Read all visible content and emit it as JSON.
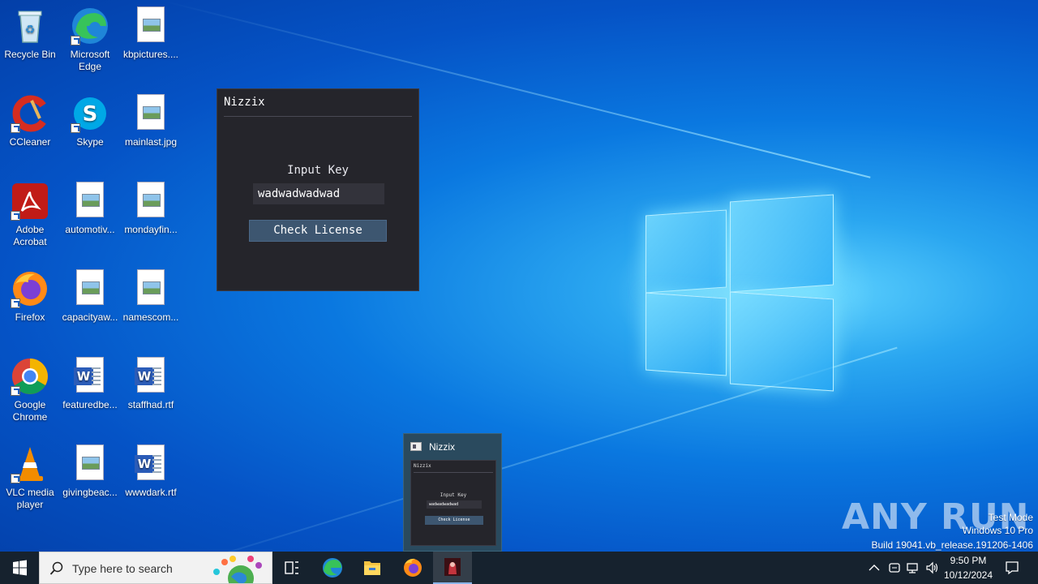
{
  "desktop": {
    "icons": [
      {
        "label": "Recycle Bin"
      },
      {
        "label": "Microsoft Edge"
      },
      {
        "label": "kbpictures...."
      },
      {
        "label": "CCleaner"
      },
      {
        "label": "Skype"
      },
      {
        "label": "mainlast.jpg"
      },
      {
        "label": "Adobe Acrobat"
      },
      {
        "label": "automotiv..."
      },
      {
        "label": "mondayfin..."
      },
      {
        "label": "Firefox"
      },
      {
        "label": "capacityaw..."
      },
      {
        "label": "namescom..."
      },
      {
        "label": "Google Chrome"
      },
      {
        "label": "featuredbe..."
      },
      {
        "label": "staffhad.rtf"
      },
      {
        "label": "VLC media player"
      },
      {
        "label": "givingbeac..."
      },
      {
        "label": "wwwdark.rtf"
      }
    ]
  },
  "app_window": {
    "title": "Nizzix",
    "input_label": "Input Key",
    "input_value": "wadwadwadwad",
    "button_label": "Check License"
  },
  "taskbar_preview": {
    "title": "Nizzix",
    "thumb_title": "Nizzix",
    "thumb_label": "Input Key",
    "thumb_value": "wadwadwadwad",
    "thumb_button": "Check License"
  },
  "watermark": {
    "brand": "ANY RUN",
    "line1": "Test Mode",
    "line2": "Windows 10 Pro",
    "line3": "Build 19041.vb_release.191206-1406"
  },
  "taskbar": {
    "search_placeholder": "Type here to search",
    "time": "9:50 PM",
    "date": "10/12/2024"
  },
  "colors": {
    "desktop_blue": "#0a78e0",
    "app_bg": "#25252b",
    "app_button": "#3d5670",
    "taskbar_bg": "#16222e"
  }
}
